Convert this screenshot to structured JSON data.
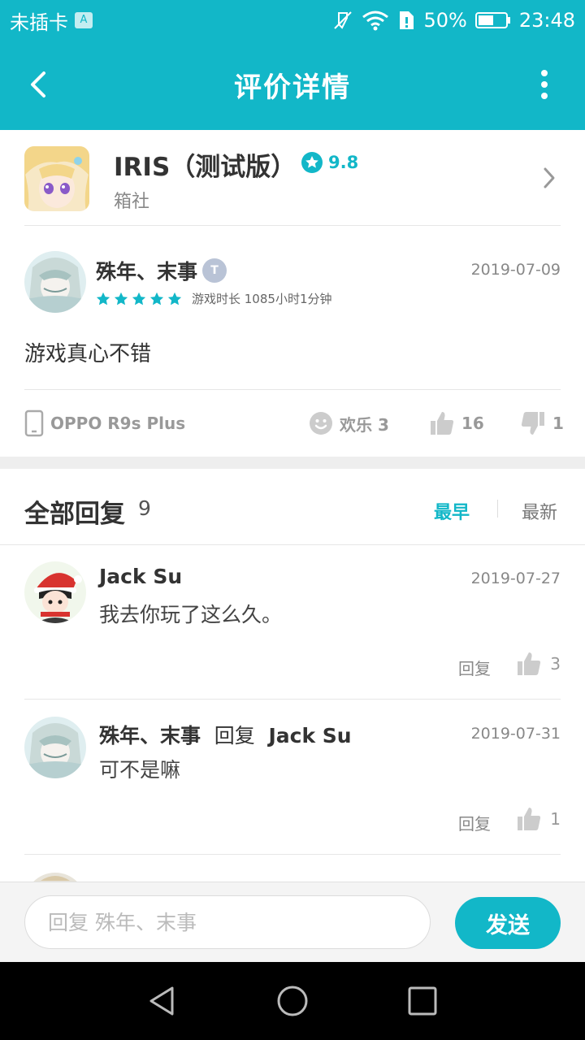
{
  "status_bar": {
    "carrier": "未插卡",
    "sim_badge": "A",
    "battery": "50%",
    "time": "23:48"
  },
  "app_bar": {
    "title": "评价详情"
  },
  "game": {
    "name": "IRIS（测试版）",
    "score": "9.8",
    "developer": "箱社"
  },
  "review": {
    "user": "殊年、末事",
    "level_badge": "T",
    "date": "2019-07-09",
    "rating_stars": 5,
    "playtime": "游戏时长 1085小时1分钟",
    "content": "游戏真心不错",
    "device": "OPPO R9s Plus",
    "fun_label": "欢乐 3",
    "likes": "16",
    "dislikes": "1"
  },
  "replies_header": {
    "label": "全部回复",
    "count": "9",
    "sort_earliest": "最早",
    "sort_newest": "最新"
  },
  "replies": [
    {
      "user": "Jack Su",
      "reply_word": "",
      "reply_to": "",
      "date": "2019-07-27",
      "text": "我去你玩了这么久。",
      "reply_label": "回复",
      "likes": "3"
    },
    {
      "user": "殊年、末事",
      "reply_word": "回复",
      "reply_to": "Jack Su",
      "date": "2019-07-31",
      "text": "可不是嘛",
      "reply_label": "回复",
      "likes": "1"
    }
  ],
  "input_bar": {
    "placeholder": "回复 殊年、末事",
    "send_label": "发送"
  },
  "colors": {
    "accent": "#12b7c8",
    "star": "#12b7c8",
    "divider": "#e6e6e6"
  }
}
